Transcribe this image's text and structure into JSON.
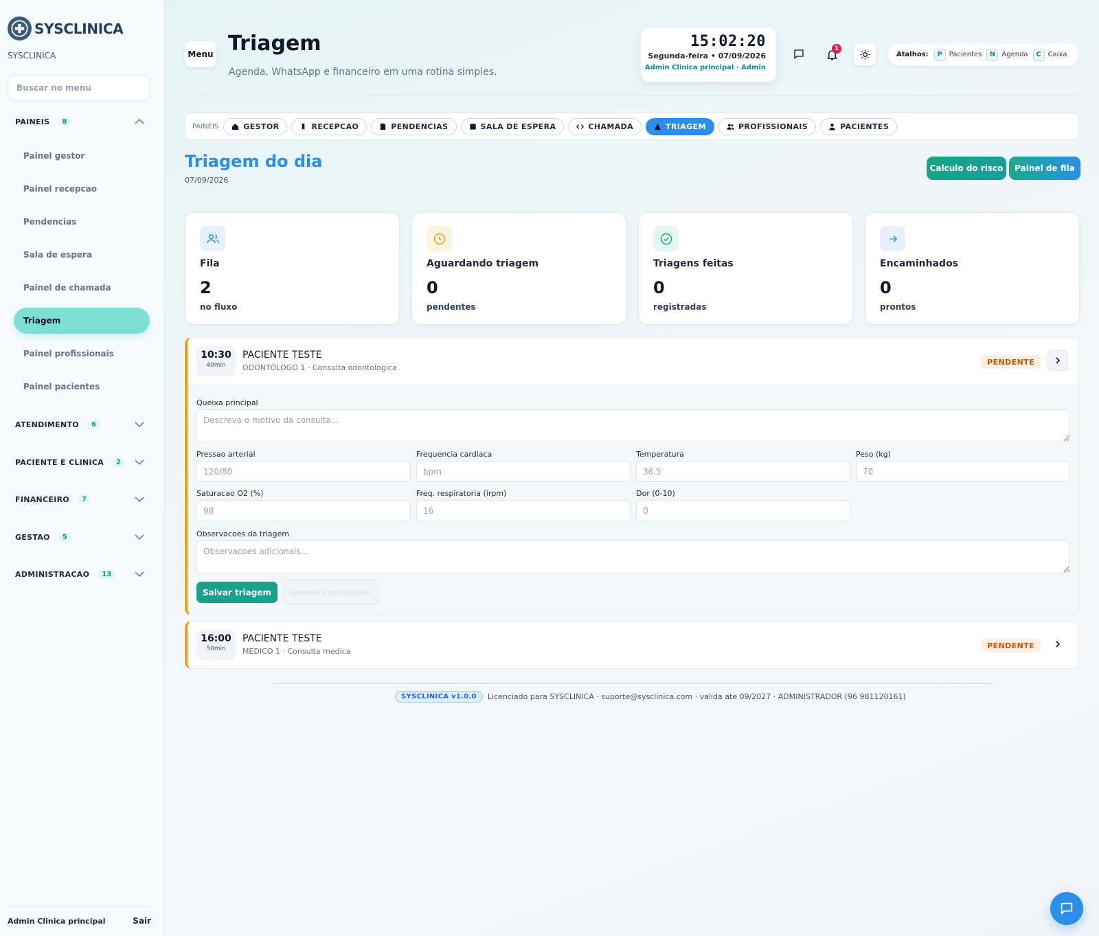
{
  "colors": {
    "accent": "#2b8ee8",
    "teal": "#1aa189",
    "pending_bg": "#fdf0e2",
    "pending_text": "#c2570c",
    "warn_border": "#f59e0b"
  },
  "sidebar": {
    "brand": "SYSCLINICA",
    "brand_sub": "SYSCLINICA",
    "search_placeholder": "Buscar no menu",
    "groups": [
      {
        "label": "PAINEIS",
        "count": "8",
        "expanded": true,
        "items": [
          "Painel gestor",
          "Painel recepcao",
          "Pendencias",
          "Sala de espera",
          "Painel de chamada",
          "Triagem",
          "Painel profissionais",
          "Painel pacientes"
        ],
        "active": "Triagem"
      },
      {
        "label": "ATENDIMENTO",
        "count": "6"
      },
      {
        "label": "PACIENTE E CLINICA",
        "count": "2"
      },
      {
        "label": "FINANCEIRO",
        "count": "7"
      },
      {
        "label": "GESTAO",
        "count": "5"
      },
      {
        "label": "ADMINISTRACAO",
        "count": "13"
      }
    ],
    "footer_user": "Admin Clinica principal",
    "logout": "Sair"
  },
  "header": {
    "menu_label": "Menu",
    "title": "Triagem",
    "subtitle": "Agenda, WhatsApp e financeiro em uma rotina simples.",
    "clock": {
      "time": "15:02:20",
      "date": "Segunda-feira • 07/09/2026",
      "user": "Admin Clinica principal · Admin"
    },
    "notif_count": "1",
    "shortcuts": {
      "label": "Atalhos:",
      "items": [
        {
          "key": "P",
          "label": "Pacientes"
        },
        {
          "key": "N",
          "label": "Agenda"
        },
        {
          "key": "C",
          "label": "Caixa"
        }
      ]
    }
  },
  "tabs": {
    "label": "PAINEIS",
    "items": [
      {
        "label": "GESTOR",
        "icon": "home-icon"
      },
      {
        "label": "RECEPCAO",
        "icon": "bookmark-icon"
      },
      {
        "label": "PENDENCIAS",
        "icon": "document-icon"
      },
      {
        "label": "SALA DE ESPERA",
        "icon": "square-icon"
      },
      {
        "label": "CHAMADA",
        "icon": "code-arrows-icon"
      },
      {
        "label": "TRIAGEM",
        "icon": "triangle-icon"
      },
      {
        "label": "PROFISSIONAIS",
        "icon": "users-icon"
      },
      {
        "label": "PACIENTES",
        "icon": "user-icon"
      }
    ],
    "active": "TRIAGEM"
  },
  "section": {
    "title": "Triagem do dia",
    "date": "07/09/2026",
    "btn_risk": "Calculo do risco",
    "btn_queue": "Painel de fila"
  },
  "stats": [
    {
      "title": "Fila",
      "value": "2",
      "caption": "no fluxo",
      "icon": "users-icon"
    },
    {
      "title": "Aguardando triagem",
      "value": "0",
      "caption": "pendentes",
      "icon": "clock-icon"
    },
    {
      "title": "Triagens feitas",
      "value": "0",
      "caption": "registradas",
      "icon": "check-circle-icon"
    },
    {
      "title": "Encaminhados",
      "value": "0",
      "caption": "prontos",
      "icon": "arrow-right-icon"
    }
  ],
  "appointments": [
    {
      "time": "10:30",
      "duration": "40min",
      "patient": "PACIENTE TESTE",
      "detail": "ODONTÓLOGO 1 · Consulta odontologica",
      "status": "PENDENTE",
      "expanded": true
    },
    {
      "time": "16:00",
      "duration": "50min",
      "patient": "PACIENTE TESTE",
      "detail": "MEDICO 1 · Consulta medica",
      "status": "PENDENTE",
      "expanded": false
    }
  ],
  "triage_form": {
    "complaint_label": "Queixa principal",
    "complaint_placeholder": "Descreva o motivo da consulta...",
    "bp_label": "Pressao arterial",
    "bp_placeholder": "120/80",
    "hr_label": "Frequencia cardiaca",
    "hr_placeholder": "bpm",
    "temp_label": "Temperatura",
    "temp_placeholder": "36.5",
    "weight_label": "Peso (kg)",
    "weight_placeholder": "70",
    "spo2_label": "Saturacao O2 (%)",
    "spo2_placeholder": "98",
    "rr_label": "Freq. respiratoria (irpm)",
    "rr_placeholder": "16",
    "pain_label": "Dor (0-10)",
    "pain_placeholder": "0",
    "notes_label": "Observacoes da triagem",
    "notes_placeholder": "Observacoes adicionais...",
    "save_label": "Salvar triagem",
    "forward_label": "Apenas encaminhar"
  },
  "footer": {
    "version": "SYSCLINICA v1.0.0",
    "license": "Licenciado para SYSCLINICA · suporte@sysclinica.com · valida ate 09/2027 · ADMINISTRADOR (96 981120161)"
  }
}
